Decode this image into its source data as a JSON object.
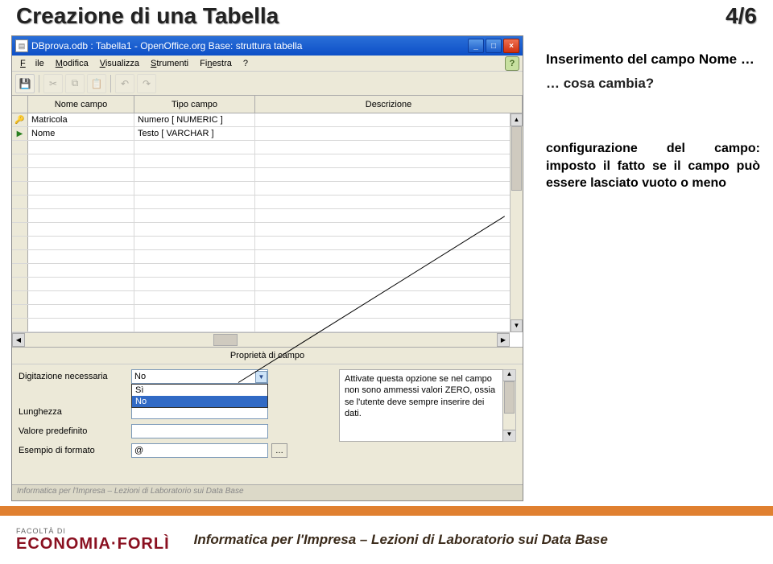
{
  "slide": {
    "title": "Creazione di una Tabella",
    "page": "4/6"
  },
  "window": {
    "title": "DBprova.odb : Tabella1 - OpenOffice.org Base: struttura tabella",
    "menus": {
      "file": "File",
      "modifica": "Modifica",
      "visualizza": "Visualizza",
      "strumenti": "Strumenti",
      "finestra": "Finestra",
      "help": "?"
    }
  },
  "grid": {
    "headers": {
      "name": "Nome campo",
      "type": "Tipo campo",
      "desc": "Descrizione"
    },
    "rows": [
      {
        "icon": "key",
        "name": "Matricola",
        "type": "Numero [ NUMERIC ]",
        "desc": ""
      },
      {
        "icon": "current",
        "name": "Nome",
        "type": "Testo [ VARCHAR ]",
        "desc": ""
      }
    ]
  },
  "props": {
    "title": "Proprietà di campo",
    "rows": {
      "required": {
        "label": "Digitazione necessaria",
        "value": "No"
      },
      "length": {
        "label": "Lunghezza",
        "value": ""
      },
      "default": {
        "label": "Valore predefinito",
        "value": ""
      },
      "format": {
        "label": "Esempio di formato",
        "value": "@"
      }
    },
    "dropdown": {
      "opt_si": "Sì",
      "opt_no": "No"
    },
    "help": "Attivate questa opzione se nel campo non sono ammessi valori ZERO, ossia se l'utente deve sempre inserire dei dati."
  },
  "hidden_caption": "Informatica per l'Impresa – Lezioni di Laboratorio sui Data Base",
  "annotations": {
    "a1": "Inserimento del campo Nome …",
    "a2": "… cosa cambia?",
    "a3": "configurazione del campo: imposto il fatto se il campo può essere lasciato vuoto o meno"
  },
  "footer": {
    "faculty": "FACOLTÀ DI",
    "dept": "ECONOMIA·FORLÌ",
    "text": "Informatica per l'Impresa – Lezioni di Laboratorio sui Data Base"
  }
}
